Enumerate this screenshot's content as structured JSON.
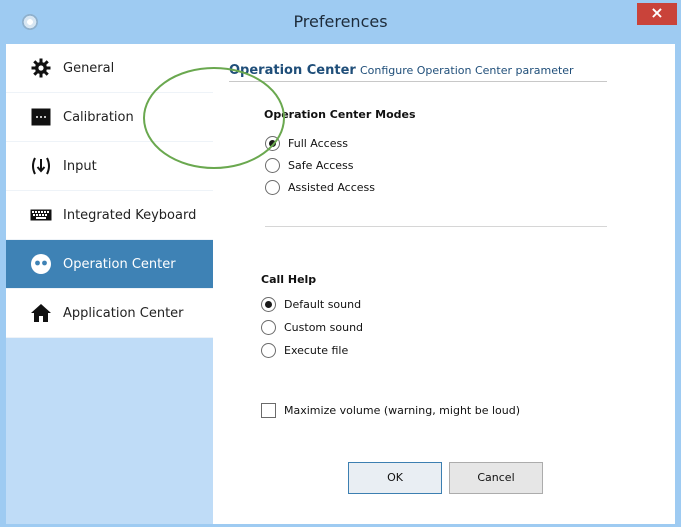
{
  "window": {
    "title": "Preferences",
    "close_label": "×"
  },
  "sidebar": {
    "items": [
      {
        "label": "General",
        "icon": "gear-icon",
        "active": false
      },
      {
        "label": "Calibration",
        "icon": "calibration-icon",
        "active": false
      },
      {
        "label": "Input",
        "icon": "input-icon",
        "active": false
      },
      {
        "label": "Integrated Keyboard",
        "icon": "keyboard-icon",
        "active": false
      },
      {
        "label": "Operation Center",
        "icon": "eyes-icon",
        "active": true
      },
      {
        "label": "Application Center",
        "icon": "home-icon",
        "active": false
      }
    ]
  },
  "main": {
    "section_title": "Operation Center",
    "section_desc": "Configure Operation Center parameter",
    "modes": {
      "label": "Operation Center Modes",
      "options": [
        {
          "label": "Full Access",
          "checked": true
        },
        {
          "label": "Safe Access",
          "checked": false
        },
        {
          "label": "Assisted Access",
          "checked": false
        }
      ]
    },
    "call_help": {
      "label": "Call Help",
      "options": [
        {
          "label": "Default sound",
          "checked": true
        },
        {
          "label": "Custom sound",
          "checked": false
        },
        {
          "label": "Execute file",
          "checked": false
        }
      ]
    },
    "maximize_volume": {
      "label": "Maximize volume (warning, might be loud)",
      "checked": false
    },
    "ok_label": "OK",
    "cancel_label": "Cancel"
  },
  "colors": {
    "window_frame": "#9ecbf2",
    "sidebar_active": "#3e82b5",
    "heading": "#1f4e79",
    "close_button": "#c9433a",
    "annotation_ellipse": "#6aa84f"
  }
}
